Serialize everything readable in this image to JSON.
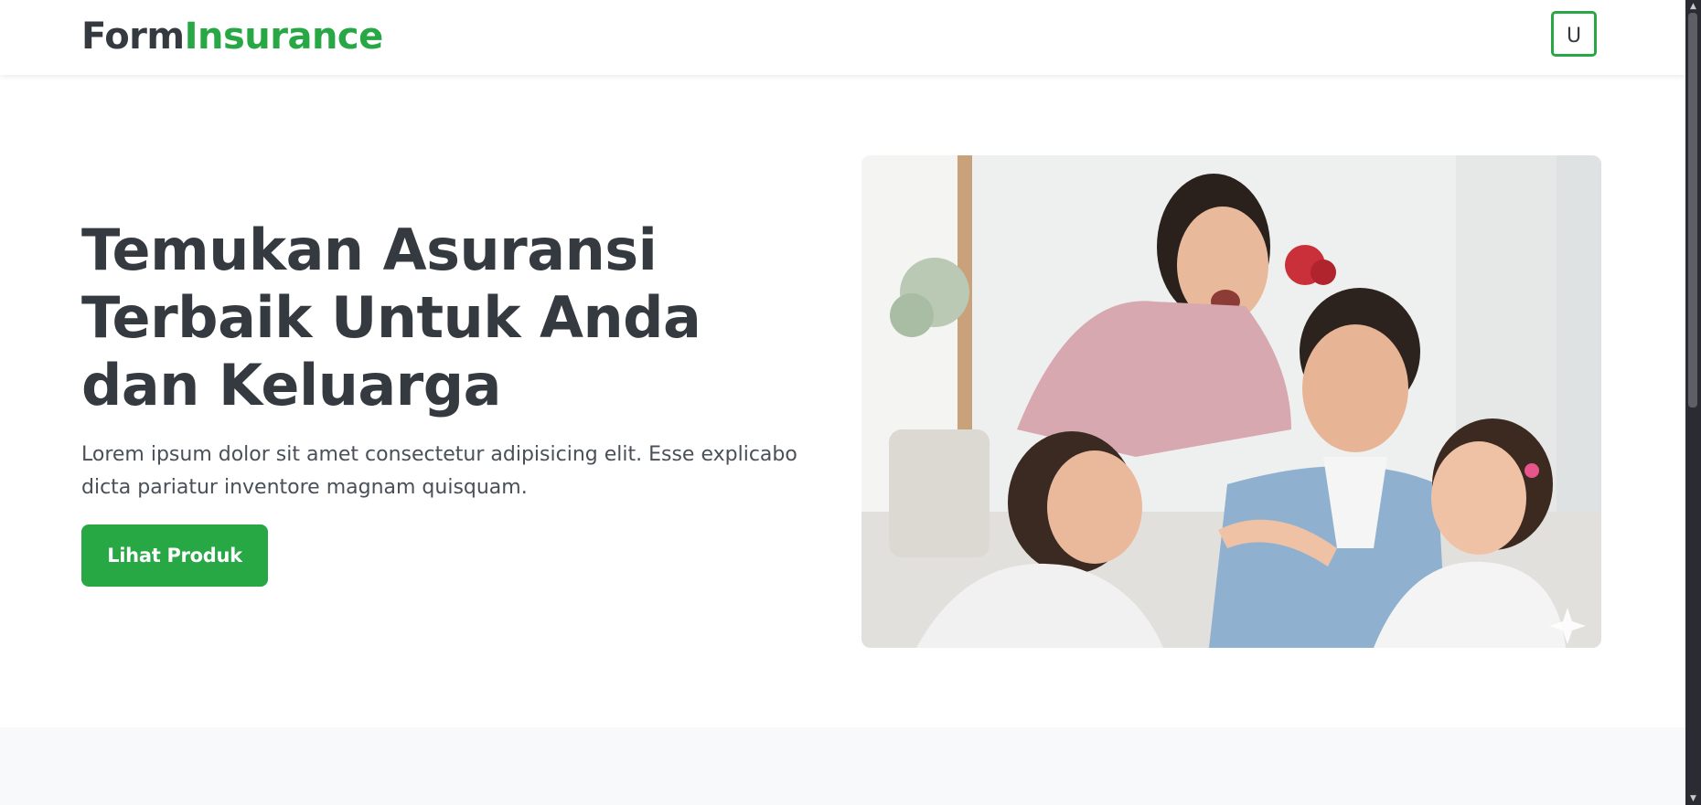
{
  "navbar": {
    "brand_part1": "Form",
    "brand_part2": "Insurance",
    "user_button_label": "U"
  },
  "hero": {
    "title": "Temukan Asuransi Terbaik Untuk Anda dan Keluarga",
    "description": "Lorem ipsum dolor sit amet consectetur adipisicing elit. Esse explicabo dicta pariatur inventore magnam quisquam.",
    "cta_label": "Lihat Produk"
  },
  "icons": {
    "scroll_up": "chevron-up-icon",
    "scroll_down": "chevron-down-icon"
  },
  "colors": {
    "brand_dark": "#343a40",
    "brand_green": "#28a745",
    "section_band": "#f8f9fa",
    "scrollbar_track": "#2b2c33"
  }
}
